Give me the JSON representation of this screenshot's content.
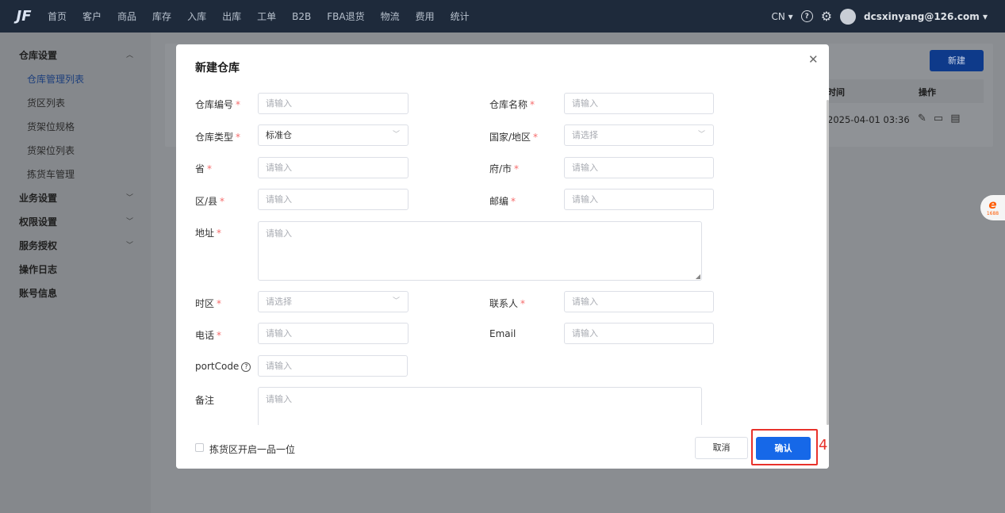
{
  "topnav": {
    "logo": "JF",
    "items": [
      "首页",
      "客户",
      "商品",
      "库存",
      "入库",
      "出库",
      "工单",
      "B2B",
      "FBA退货",
      "物流",
      "费用",
      "统计"
    ],
    "language": "CN ▾",
    "help_icon": "?",
    "settings_icon": "⚙",
    "user": "dcsxinyang@126.com ▾"
  },
  "sidebar": {
    "group_warehouse": "仓库设置",
    "sub_items": [
      "仓库管理列表",
      "货区列表",
      "货架位规格",
      "货架位列表",
      "拣货车管理"
    ],
    "groups": [
      "业务设置",
      "权限设置",
      "服务授权",
      "操作日志",
      "账号信息"
    ]
  },
  "background_table": {
    "new_button": "新建",
    "col_time": "时间",
    "col_action": "操作",
    "row_time": "2025-04-01 03:36"
  },
  "badge": {
    "top": "e",
    "text": "1688"
  },
  "modal": {
    "title": "新建仓库",
    "close": "✕",
    "fields": {
      "warehouse_code": {
        "label": "仓库编号",
        "placeholder": "请输入",
        "required": "*"
      },
      "warehouse_name": {
        "label": "仓库名称",
        "placeholder": "请输入",
        "required": "*"
      },
      "warehouse_type": {
        "label": "仓库类型",
        "value": "标准仓",
        "required": "*"
      },
      "country": {
        "label": "国家/地区",
        "placeholder": "请选择",
        "required": "*"
      },
      "province": {
        "label": "省",
        "placeholder": "请输入",
        "required": "*"
      },
      "city": {
        "label": "府/市",
        "placeholder": "请输入",
        "required": "*"
      },
      "district": {
        "label": "区/县",
        "placeholder": "请输入",
        "required": "*"
      },
      "postcode": {
        "label": "邮编",
        "placeholder": "请输入",
        "required": "*"
      },
      "address": {
        "label": "地址",
        "placeholder": "请输入",
        "required": "*"
      },
      "timezone": {
        "label": "时区",
        "placeholder": "请选择",
        "required": "*"
      },
      "contact": {
        "label": "联系人",
        "placeholder": "请输入",
        "required": "*"
      },
      "phone": {
        "label": "电话",
        "placeholder": "请输入",
        "required": "*"
      },
      "email": {
        "label": "Email",
        "placeholder": "请输入"
      },
      "port_code": {
        "label": "portCode",
        "placeholder": "请输入",
        "help": "?"
      },
      "remark": {
        "label": "备注",
        "placeholder": "请输入"
      }
    },
    "footer": {
      "checkbox_label": "拣货区开启一品一位",
      "cancel": "取消",
      "confirm": "确认"
    }
  },
  "annotation": {
    "step": "4",
    "color": "#e8322b"
  },
  "colors": {
    "primary": "#1668e8",
    "topbar": "#1e2a3b",
    "required": "#f56c6c"
  }
}
